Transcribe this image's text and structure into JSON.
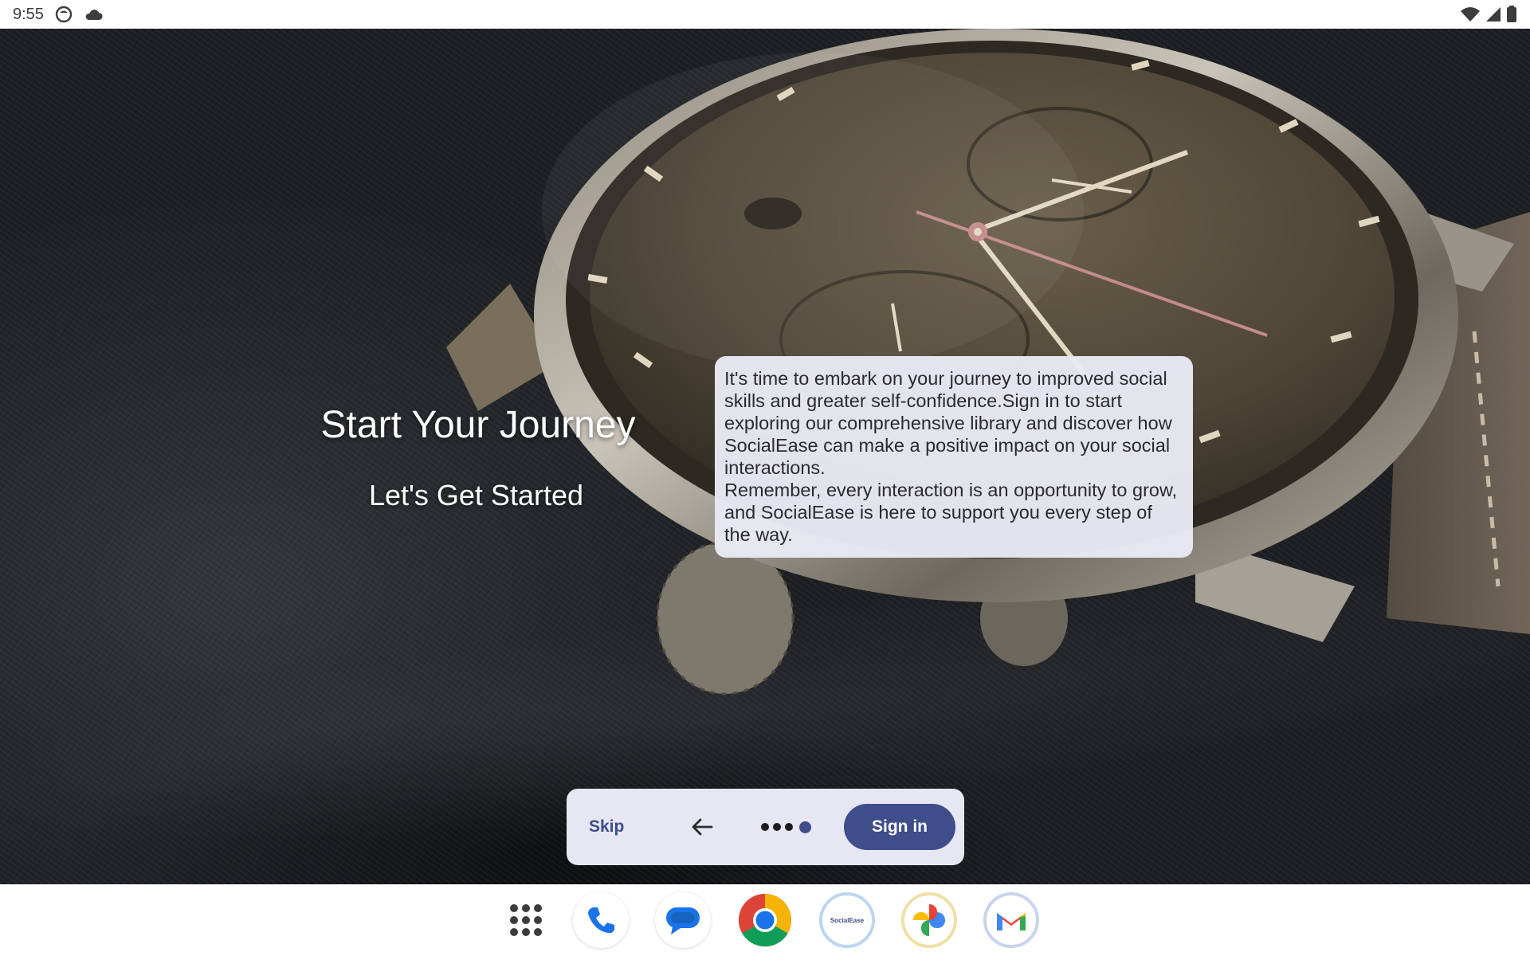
{
  "status_bar": {
    "time": "9:55"
  },
  "hero": {
    "title": "Start Your Journey",
    "subtitle": "Let's Get Started"
  },
  "message_card": {
    "paragraph_1": "It's time to embark on your journey to improved social skills and greater self-confidence.Sign in to start exploring our comprehensive library and discover how SocialEase can make a positive impact on your social interactions.",
    "paragraph_2": "Remember, every interaction is an opportunity to grow, and SocialEase is here to support you every step of the way."
  },
  "onboarding_nav": {
    "skip_label": "Skip",
    "sign_in_label": "Sign in",
    "page_count": 4,
    "current_page": 4
  },
  "dock": {
    "apps": [
      "app-drawer",
      "phone",
      "messages",
      "chrome",
      "socialease",
      "photos",
      "gmail"
    ],
    "socialease_label": "SocialEase"
  },
  "colors": {
    "primary": "#3f4d8a",
    "card_bg": "#e8e9f3",
    "nav_bg": "#e6e7f2"
  }
}
